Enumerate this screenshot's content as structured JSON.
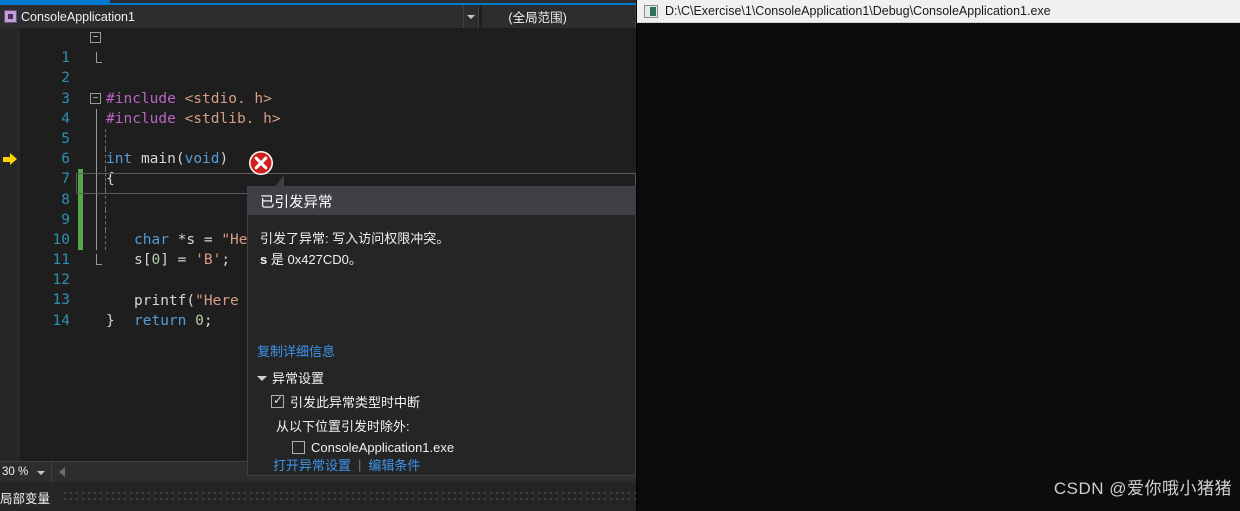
{
  "ide": {
    "nav_bar": {
      "project_scope": "ConsoleApplication1",
      "member_scope": "(全局范围)",
      "project_icon": "project-icon",
      "dropdown_icon": "chevron-down-icon"
    },
    "editor": {
      "zoom_level": "30 %",
      "lines": [
        {
          "num": "1",
          "text": "#include <stdio. h>"
        },
        {
          "num": "2",
          "text": "#include <stdlib. h>"
        },
        {
          "num": "3",
          "text": ""
        },
        {
          "num": "4",
          "text": "int main(void)"
        },
        {
          "num": "5",
          "text": "{"
        },
        {
          "num": "6",
          "text": "char *s = \"Hello World\";"
        },
        {
          "num": "7",
          "text": "s[0] = 'B';"
        },
        {
          "num": "8",
          "text": ""
        },
        {
          "num": "9",
          "text": "printf(\"Here"
        },
        {
          "num": "10",
          "text": ""
        },
        {
          "num": "11",
          "text": "return 0;"
        },
        {
          "num": "12",
          "text": "}"
        },
        {
          "num": "13",
          "text": ""
        },
        {
          "num": "14",
          "text": ""
        }
      ]
    },
    "exception_dialog": {
      "error_icon": "error-circle-x-icon",
      "title": "已引发异常",
      "message_line1": "引发了异常: 写入访问权限冲突。",
      "message_var": "s",
      "message_line2_rest": " 是 0x427CD0。",
      "copy_details_link": "复制详细信息",
      "settings_group_label": "异常设置",
      "break_checkbox_label": "引发此异常类型时中断",
      "break_checkbox_checked": true,
      "except_when_label": "从以下位置引发时除外:",
      "module_checkbox_label": "ConsoleApplication1.exe",
      "module_checkbox_checked": false,
      "open_settings_link": "打开异常设置",
      "link_separator": "|",
      "edit_conditions_link": "编辑条件"
    },
    "bottom_panel": {
      "title": "局部变量"
    }
  },
  "console": {
    "title": "D:\\C\\Exercise\\1\\ConsoleApplication1\\Debug\\ConsoleApplication1.exe",
    "icon": "console-window-icon",
    "output": ""
  },
  "watermark": {
    "text": "CSDN @爱你哦小猪猪"
  },
  "colors": {
    "accent": "#007acc",
    "editor_bg": "#1e1e1e",
    "chrome_bg": "#2d2d30",
    "dialog_bg": "#252526",
    "dialog_header_bg": "#3f3f46",
    "link": "#3b95ec",
    "error_red": "#d01f1f",
    "exec_arrow_yellow": "#ffd400",
    "change_bar_green": "#57a64a",
    "line_number": "#2b91af",
    "console_bg": "#0c0c0c"
  }
}
